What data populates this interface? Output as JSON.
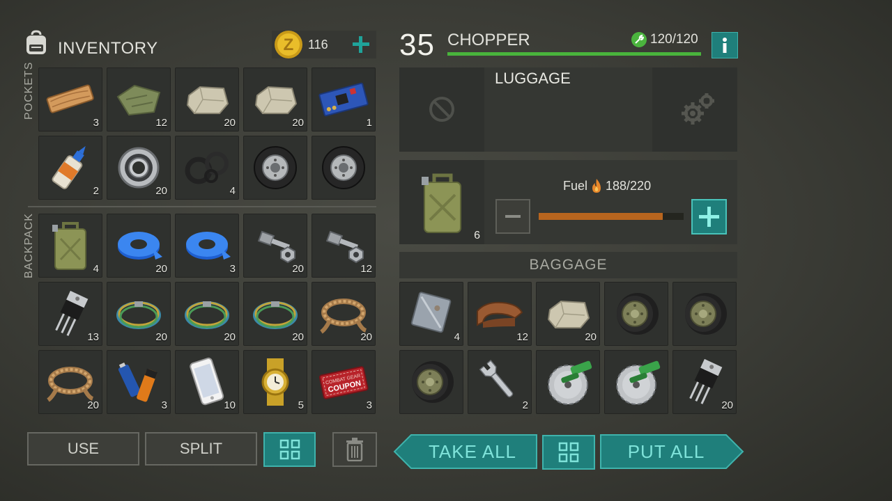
{
  "inventory": {
    "title": "INVENTORY",
    "coins": "116",
    "pockets_label": "POCKETS",
    "backpack_label": "BACKPACK",
    "pockets": [
      {
        "icon": "wood-plank-icon",
        "count": "3"
      },
      {
        "icon": "cloth-icon",
        "count": "12"
      },
      {
        "icon": "stone-icon",
        "count": "20"
      },
      {
        "icon": "stone-icon",
        "count": "20"
      },
      {
        "icon": "circuit-board-icon",
        "count": "1"
      },
      {
        "icon": "glue-icon",
        "count": "2"
      },
      {
        "icon": "bearing-icon",
        "count": "20"
      },
      {
        "icon": "rubber-seals-icon",
        "count": "4"
      },
      {
        "icon": "wheel-icon",
        "count": ""
      },
      {
        "icon": "wheel-icon",
        "count": ""
      }
    ],
    "backpack": [
      {
        "icon": "jerrycan-icon",
        "count": "4"
      },
      {
        "icon": "duct-tape-icon",
        "count": "20"
      },
      {
        "icon": "duct-tape-icon",
        "count": "3"
      },
      {
        "icon": "bolts-icon",
        "count": "20"
      },
      {
        "icon": "bolts-icon",
        "count": "12"
      },
      {
        "icon": "transistor-icon",
        "count": "13"
      },
      {
        "icon": "wire-coil-icon",
        "count": "20"
      },
      {
        "icon": "wire-coil-icon",
        "count": "20"
      },
      {
        "icon": "wire-coil-icon",
        "count": "20"
      },
      {
        "icon": "rope-icon",
        "count": "20"
      },
      {
        "icon": "rope-icon",
        "count": "20"
      },
      {
        "icon": "batteries-icon",
        "count": "3"
      },
      {
        "icon": "phone-icon",
        "count": "10"
      },
      {
        "icon": "watch-icon",
        "count": "5"
      },
      {
        "icon": "coupon-icon",
        "count": "3"
      }
    ],
    "coupon_text": [
      "COMBAT GEAR",
      "COUPON"
    ]
  },
  "vehicle": {
    "level": "35",
    "name": "CHOPPER",
    "durability": "120/120",
    "durability_fraction": 1.0,
    "luggage_label": "LUGGAGE",
    "fuel_label": "Fuel",
    "fuel_value": "188/220",
    "fuel_fraction": 0.855,
    "fuel_can_count": "6",
    "baggage_label": "BAGGAGE",
    "baggage": [
      {
        "icon": "metal-sheet-icon",
        "count": "4"
      },
      {
        "icon": "leather-icon",
        "count": "12"
      },
      {
        "icon": "stone-icon",
        "count": "20"
      },
      {
        "icon": "motorcycle-wheel-icon",
        "count": ""
      },
      {
        "icon": "motorcycle-wheel-icon",
        "count": ""
      },
      {
        "icon": "motorcycle-wheel-icon",
        "count": ""
      },
      {
        "icon": "wrench-icon",
        "count": "2"
      },
      {
        "icon": "saw-blade-icon",
        "count": ""
      },
      {
        "icon": "saw-blade-icon",
        "count": ""
      },
      {
        "icon": "transistor-icon",
        "count": "20"
      }
    ]
  },
  "actions": {
    "use": "USE",
    "split": "SPLIT",
    "take_all": "TAKE ALL",
    "put_all": "PUT ALL"
  },
  "colors": {
    "accent_teal": "#1f7f7b",
    "health_green": "#49b43c",
    "fuel_orange": "#b8651e",
    "coin_gold": "#e2b524"
  }
}
